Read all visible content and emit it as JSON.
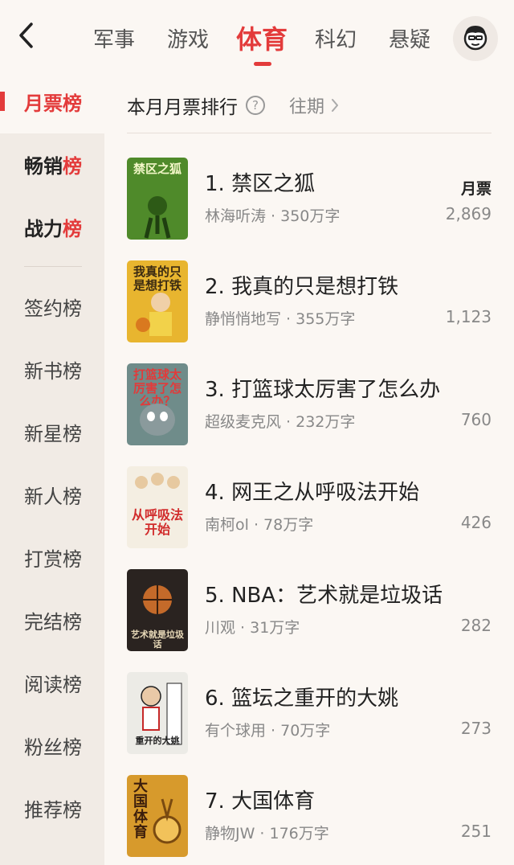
{
  "header": {
    "tabs": [
      {
        "label": "军事"
      },
      {
        "label": "游戏"
      },
      {
        "label": "体育"
      },
      {
        "label": "科幻"
      },
      {
        "label": "悬疑"
      }
    ]
  },
  "sidebar": {
    "items": [
      {
        "label": "月票榜"
      },
      {
        "prefix": "畅销",
        "suffix": "榜"
      },
      {
        "prefix": "战力",
        "suffix": "榜"
      },
      {
        "label": "签约榜"
      },
      {
        "label": "新书榜"
      },
      {
        "label": "新星榜"
      },
      {
        "label": "新人榜"
      },
      {
        "label": "打赏榜"
      },
      {
        "label": "完结榜"
      },
      {
        "label": "阅读榜"
      },
      {
        "label": "粉丝榜"
      },
      {
        "label": "推荐榜"
      }
    ]
  },
  "content": {
    "title": "本月月票排行",
    "help": "?",
    "past_label": "往期",
    "vote_label": "月票"
  },
  "books": [
    {
      "title": "1. 禁区之狐",
      "meta": "林海听涛 · 350万字",
      "votes": "2,869",
      "cover_text": "禁区之狐",
      "cover_bg": "#4f8a2a",
      "cover_fg": "#f3f7c8"
    },
    {
      "title": "2. 我真的只是想打铁",
      "meta": "静悄悄地写 · 355万字",
      "votes": "1,123",
      "cover_text": "我真的只是想打铁",
      "cover_bg": "#e8b52f",
      "cover_fg": "#3a2a12"
    },
    {
      "title": "3. 打篮球太厉害了怎么办",
      "meta": "超级麦克风 · 232万字",
      "votes": "760",
      "cover_text": "打篮球太厉害了怎么办？",
      "cover_bg": "#6f8c8a",
      "cover_fg": "#e23a3a"
    },
    {
      "title": "4. 网王之从呼吸法开始",
      "meta": "南柯ol · 78万字",
      "votes": "426",
      "cover_text": "从呼吸法开始",
      "cover_bg": "#f4eee2",
      "cover_fg": "#d12c2c"
    },
    {
      "title": "5. NBA：艺术就是垃圾话",
      "meta": "川观 · 31万字",
      "votes": "282",
      "cover_text": "艺术就是垃圾话",
      "cover_bg": "#2a2320",
      "cover_fg": "#e8d9b8"
    },
    {
      "title": "6. 篮坛之重开的大姚",
      "meta": "有个球用 · 70万字",
      "votes": "273",
      "cover_text": "重开的大姚",
      "cover_bg": "#ecebe6",
      "cover_fg": "#222222"
    },
    {
      "title": "7. 大国体育",
      "meta": "静物JW · 176万字",
      "votes": "251",
      "cover_text": "大国体育",
      "cover_bg": "#d79a2c",
      "cover_fg": "#3b1d0c"
    }
  ]
}
